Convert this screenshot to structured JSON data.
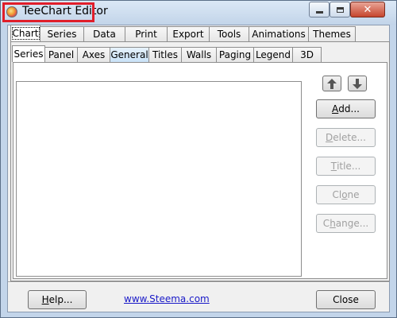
{
  "window": {
    "title": "TeeChart Editor",
    "buttons": {
      "minimize": "minimize-icon",
      "maximize": "maximize-icon",
      "close": "close-icon"
    }
  },
  "main_tabs": [
    "Chart",
    "Series",
    "Data",
    "Print",
    "Export",
    "Tools",
    "Animations",
    "Themes"
  ],
  "sub_tabs": [
    "Series",
    "Panel",
    "Axes",
    "General",
    "Titles",
    "Walls",
    "Paging",
    "Legend",
    "3D"
  ],
  "series_buttons": {
    "add_accel": "A",
    "add_rest": "dd...",
    "delete_accel": "D",
    "delete_rest": "elete...",
    "title_accel": "T",
    "title_rest": "itle...",
    "clone_pre": "Cl",
    "clone_accel": "o",
    "clone_post": "ne",
    "change_pre": "C",
    "change_accel": "h",
    "change_post": "ange..."
  },
  "footer": {
    "help_accel": "H",
    "help_rest": "elp...",
    "link": "www.Steema.com",
    "close": "Close"
  },
  "colors": {
    "highlight": "#e01e2a",
    "link": "#1a1ac8"
  }
}
